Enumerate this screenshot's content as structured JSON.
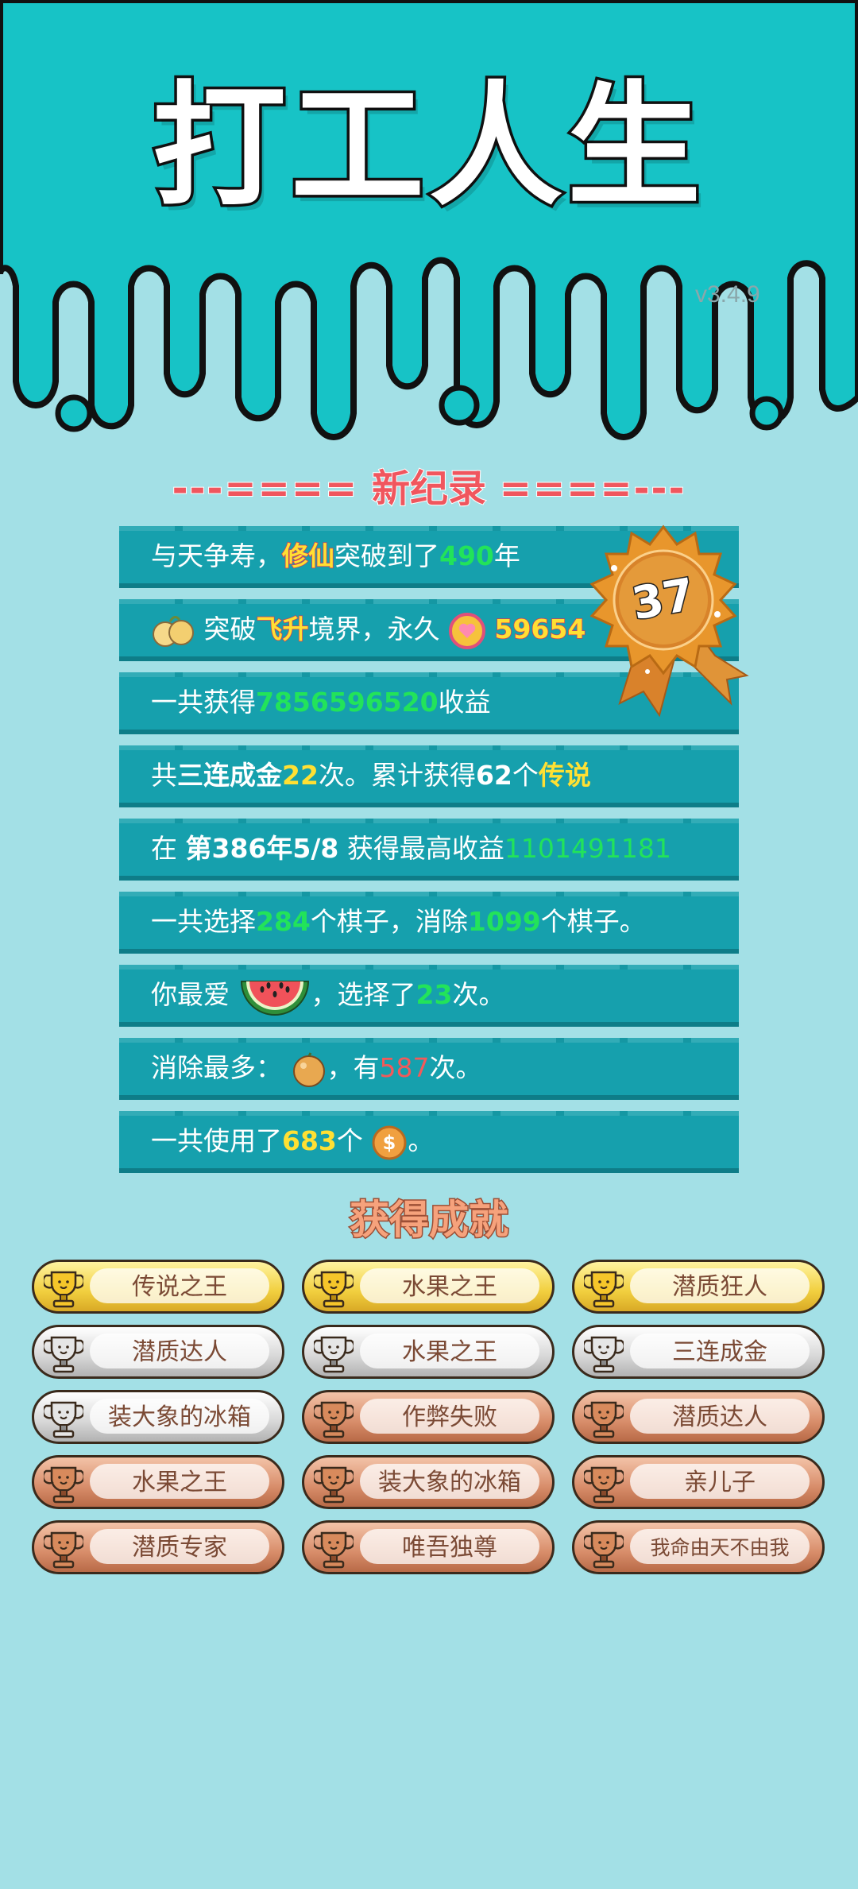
{
  "app": {
    "title": "打工人生",
    "version": "v3.4.9"
  },
  "record_header": {
    "left": "---====",
    "label": "新纪录",
    "right": "====---"
  },
  "badge": {
    "number": "37"
  },
  "records": [
    {
      "a": "与天争寿，",
      "b": "修仙",
      "c": "突破到了",
      "d": "490",
      "e": "年"
    },
    {
      "a": "突破",
      "b": "飞升",
      "c": "境界，永久",
      "d": "59654"
    },
    {
      "a": "一共获得",
      "b": "7856596520",
      "c": "收益"
    },
    {
      "a": "共",
      "b": "三连成金",
      "c": "22",
      "d": "次。累计获得",
      "e": "62",
      "f": "个",
      "g": "传说"
    },
    {
      "a": "在 ",
      "b": "第386年5/8",
      "c": " 获得最高收益",
      "d": "1101491181"
    },
    {
      "a": "一共选择",
      "b": "284",
      "c": "个棋子，消除",
      "d": "1099",
      "e": "个棋子。"
    },
    {
      "a": "你最爱",
      "b": "，选择了",
      "c": "23",
      "d": "次。"
    },
    {
      "a": "消除最多：",
      "b": "，有",
      "c": "587",
      "d": "次。"
    },
    {
      "a": "一共使用了",
      "b": "683",
      "c": "个",
      "d": "。"
    }
  ],
  "achievements": {
    "title": "获得成就",
    "items": [
      {
        "label": "传说之王",
        "tier": "gold"
      },
      {
        "label": "水果之王",
        "tier": "gold"
      },
      {
        "label": "潜质狂人",
        "tier": "gold"
      },
      {
        "label": "潜质达人",
        "tier": "silver"
      },
      {
        "label": "水果之王",
        "tier": "silver"
      },
      {
        "label": "三连成金",
        "tier": "silver"
      },
      {
        "label": "装大象的冰箱",
        "tier": "silver"
      },
      {
        "label": "作弊失败",
        "tier": "bronze"
      },
      {
        "label": "潜质达人",
        "tier": "bronze"
      },
      {
        "label": "水果之王",
        "tier": "bronze"
      },
      {
        "label": "装大象的冰箱",
        "tier": "bronze"
      },
      {
        "label": "亲儿子",
        "tier": "bronze"
      },
      {
        "label": "潜质专家",
        "tier": "bronze"
      },
      {
        "label": "唯吾独尊",
        "tier": "bronze"
      },
      {
        "label": "我命由天不由我",
        "tier": "bronze"
      }
    ]
  },
  "colors": {
    "top_bg": "#17c3c6",
    "page_bg": "#a3e0e6",
    "row_bg": "#16a0ad",
    "highlight_green": "#22e35a",
    "highlight_yellow": "#ffe033",
    "highlight_red": "#f25a5a"
  }
}
